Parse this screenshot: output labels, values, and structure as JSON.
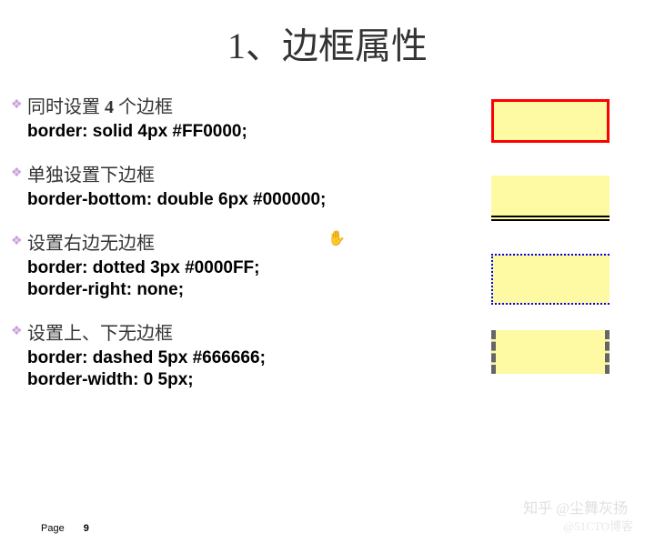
{
  "title": "1、边框属性",
  "items": [
    {
      "desc_prefix": "同时设置 ",
      "desc_bold": "4",
      "desc_suffix": " 个边框",
      "code": [
        "border: solid 4px #FF0000;"
      ]
    },
    {
      "desc_prefix": "单独设置下边框",
      "desc_bold": "",
      "desc_suffix": "",
      "code": [
        "border-bottom: double 6px #000000;"
      ]
    },
    {
      "desc_prefix": "设置右边无边框",
      "desc_bold": "",
      "desc_suffix": "",
      "code": [
        "border: dotted 3px #0000FF;",
        "border-right: none;"
      ]
    },
    {
      "desc_prefix": "设置上、下无边框",
      "desc_bold": "",
      "desc_suffix": "",
      "code": [
        "border: dashed 5px #666666;",
        "border-width: 0 5px;"
      ]
    }
  ],
  "footer": {
    "label": "Page",
    "number": "9"
  },
  "watermark1": "知乎 @尘舞灰扬",
  "watermark2": "@51CTO博客",
  "cursor": "✋"
}
